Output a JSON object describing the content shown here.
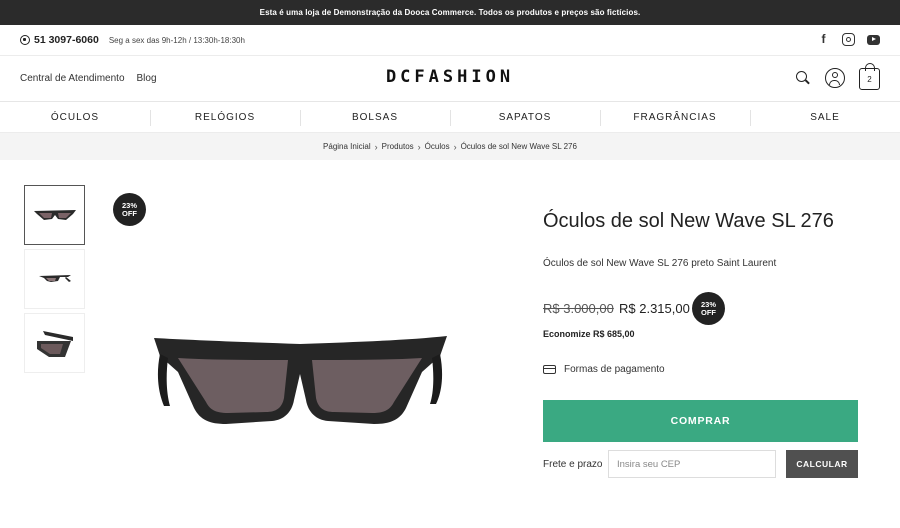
{
  "topbar": {
    "text": "Esta é uma loja de Demonstração da Dooca Commerce. Todos os produtos e preços são fictícios."
  },
  "contact": {
    "phone": "51 3097-6060",
    "hours": "Seg a sex das 9h-12h / 13:30h-18:30h"
  },
  "social": [
    "facebook-icon",
    "instagram-icon",
    "youtube-icon"
  ],
  "header": {
    "links": [
      "Central de Atendimento",
      "Blog"
    ],
    "logo": "DCFASHION",
    "cart_count": "2"
  },
  "nav": [
    "ÓCULOS",
    "RELÓGIOS",
    "BOLSAS",
    "SAPATOS",
    "FRAGRÂNCIAS",
    "SALE"
  ],
  "breadcrumb": [
    "Página Inicial",
    "Produtos",
    "Óculos",
    "Óculos de sol New Wave SL 276"
  ],
  "badge": {
    "percent": "23%",
    "label": "OFF"
  },
  "product": {
    "title": "Óculos de sol New Wave SL 276",
    "subtitle": "Óculos de sol New Wave SL 276 preto Saint Laurent",
    "old_price": "R$ 3.000,00",
    "new_price": "R$ 2.315,00",
    "economize": "Economize R$ 685,00",
    "payment_label": "Formas de pagamento",
    "buy_label": "COMPRAR",
    "shipping_label": "Frete e prazo",
    "cep_placeholder": "Insira seu CEP",
    "calc_label": "CALCULAR"
  },
  "colors": {
    "buy_button": "#3aa982",
    "topbar": "#2b2b2b",
    "calc_button": "#505050"
  }
}
